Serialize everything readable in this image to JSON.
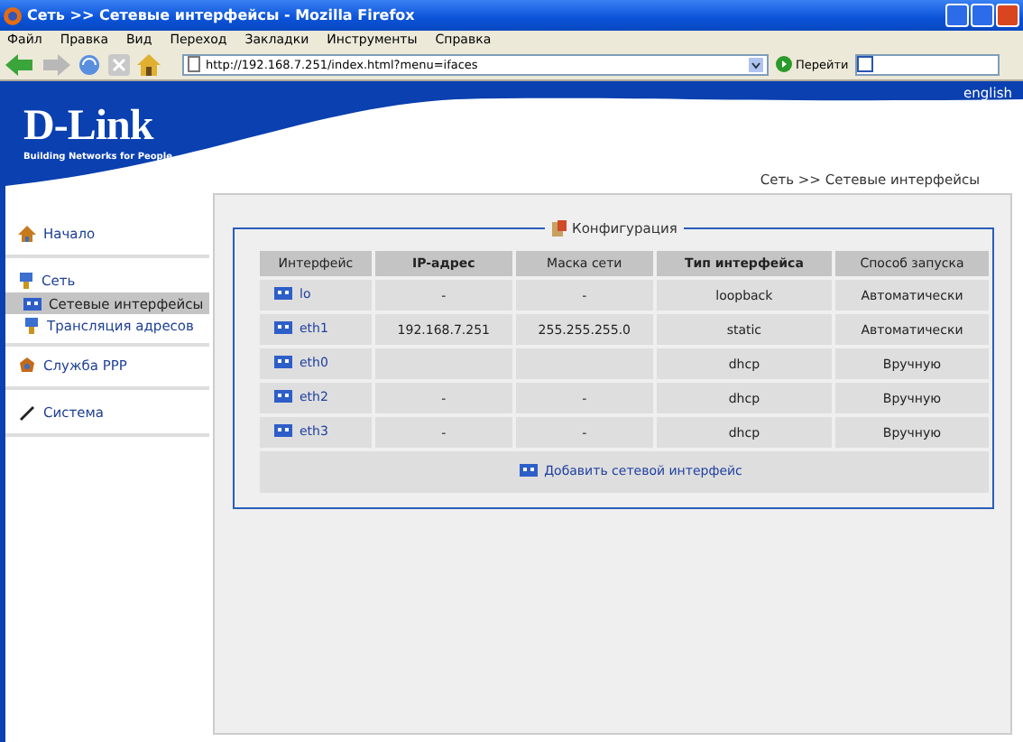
{
  "window": {
    "title": "Сеть >> Сетевые интерфейсы - Mozilla Firefox"
  },
  "menu": [
    "Файл",
    "Правка",
    "Вид",
    "Переход",
    "Закладки",
    "Инструменты",
    "Справка"
  ],
  "toolbar": {
    "address": "http://192.168.7.251/index.html?menu=ifaces",
    "go": "Перейти"
  },
  "header": {
    "logo": "D-Link",
    "tagline": "Building Networks for People",
    "language": "english",
    "breadcrumb": "Сеть >> Сетевые интерфейсы"
  },
  "sidebar": [
    {
      "kind": "section",
      "label": "Начало",
      "selected": false
    },
    {
      "kind": "section",
      "label": "Сеть",
      "selected": false
    },
    {
      "kind": "sub",
      "label": "Сетевые интерфейсы",
      "selected": true
    },
    {
      "kind": "sub",
      "label": "Трансляция адресов",
      "selected": false
    },
    {
      "kind": "section",
      "label": "Служба PPP",
      "selected": false
    },
    {
      "kind": "section",
      "label": "Система",
      "selected": false
    }
  ],
  "config": {
    "legend": "Конфигурация",
    "columns": [
      "Интерфейс",
      "IP-адрес",
      "Маска сети",
      "Тип интерфейса",
      "Способ запуска"
    ],
    "rows": [
      [
        "lo",
        "-",
        "-",
        "loopback",
        "Автоматически"
      ],
      [
        "eth1",
        "192.168.7.251",
        "255.255.255.0",
        "static",
        "Автоматически"
      ],
      [
        "eth0",
        "",
        "",
        "dhcp",
        "Вручную"
      ],
      [
        "eth2",
        "-",
        "-",
        "dhcp",
        "Вручную"
      ],
      [
        "eth3",
        "-",
        "-",
        "dhcp",
        "Вручную"
      ]
    ],
    "add_link": "Добавить сетевой интерфейс"
  }
}
